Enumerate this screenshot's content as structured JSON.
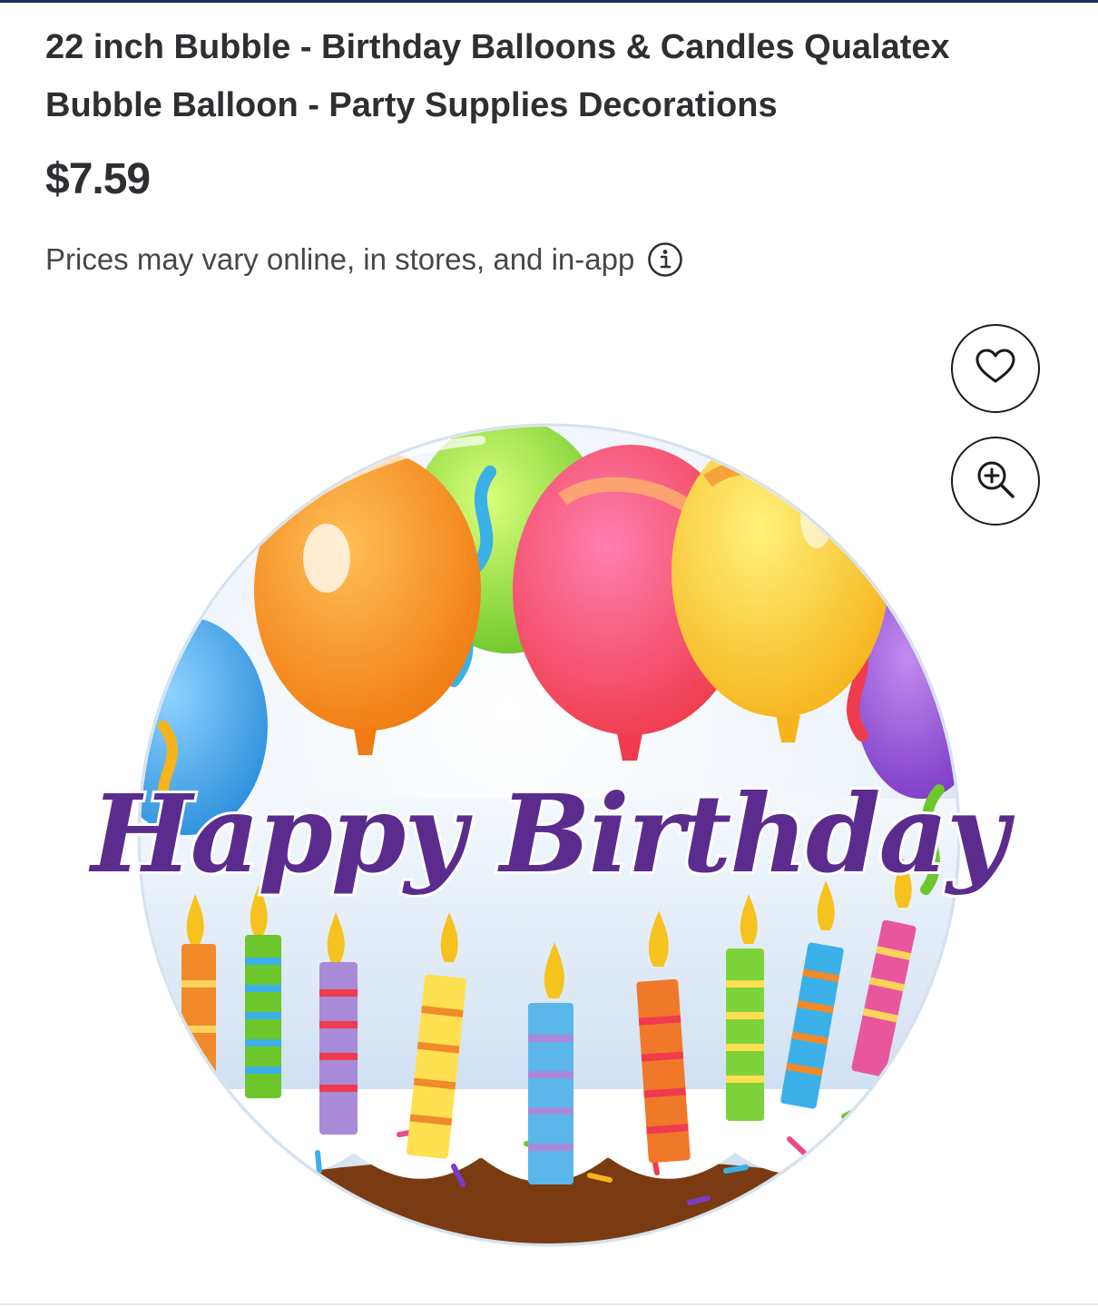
{
  "product": {
    "title": "22 inch Bubble - Birthday Balloons & Candles Qualatex Bubble Balloon - Party Supplies Decorations",
    "price": "$7.59",
    "price_note": "Prices may vary online, in stores, and in-app",
    "image": {
      "lettering": "Happy Birthday",
      "icon": "birthday-bubble-balloon"
    }
  },
  "actions": {
    "favorite_icon": "heart-icon",
    "zoom_icon": "zoom-in-icon",
    "info_icon": "info-icon"
  },
  "colors": {
    "header_bar": "#1a2c5b",
    "text": "#2e2f32",
    "lettering": "#5b2c8e"
  }
}
